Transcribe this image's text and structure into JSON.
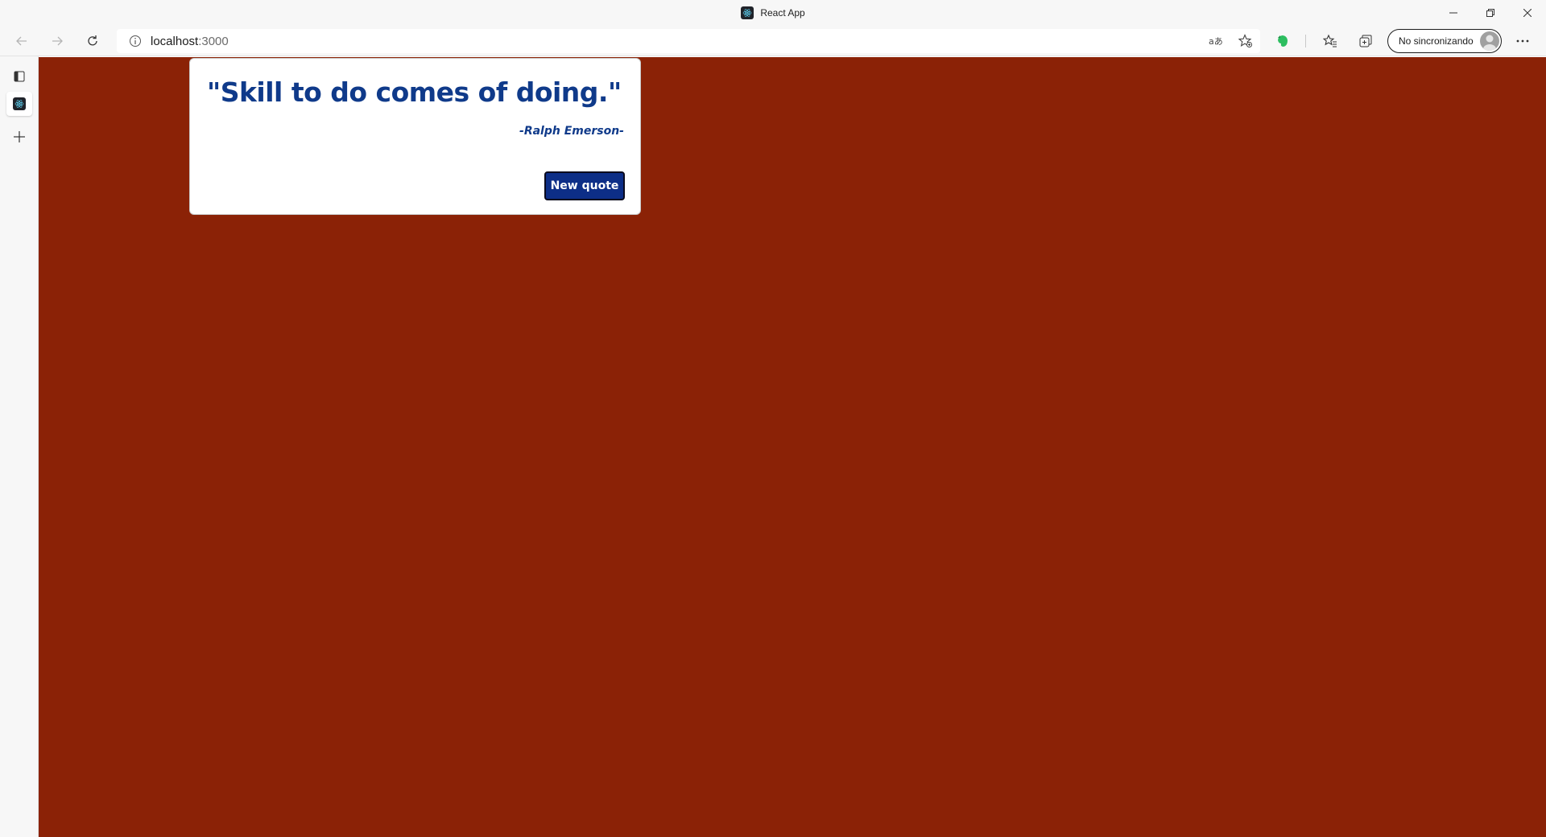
{
  "window": {
    "title": "React App",
    "favicon": "react-icon"
  },
  "toolbar": {
    "url_host": "localhost",
    "url_port": ":3000",
    "profile_label": "No sincronizando"
  },
  "page": {
    "background_color": "#8b2206",
    "quote_text": "\"Skill to do comes of doing.\"",
    "quote_author": "-Ralph Emerson-",
    "new_quote_button": "New quote",
    "accent_color": "#0f3a8a",
    "button_color": "#0d2e87"
  },
  "icons": {
    "back": "back-arrow-icon",
    "forward": "forward-arrow-icon",
    "refresh": "refresh-icon",
    "site_info": "info-icon",
    "read_aloud": "read-aloud-icon",
    "add_favorite": "add-favorite-icon",
    "extension": "evernote-extension-icon",
    "favorites": "favorites-icon",
    "collections": "collections-icon",
    "more": "more-icon",
    "tab_actions": "tab-actions-icon",
    "new_tab": "new-tab-icon"
  }
}
